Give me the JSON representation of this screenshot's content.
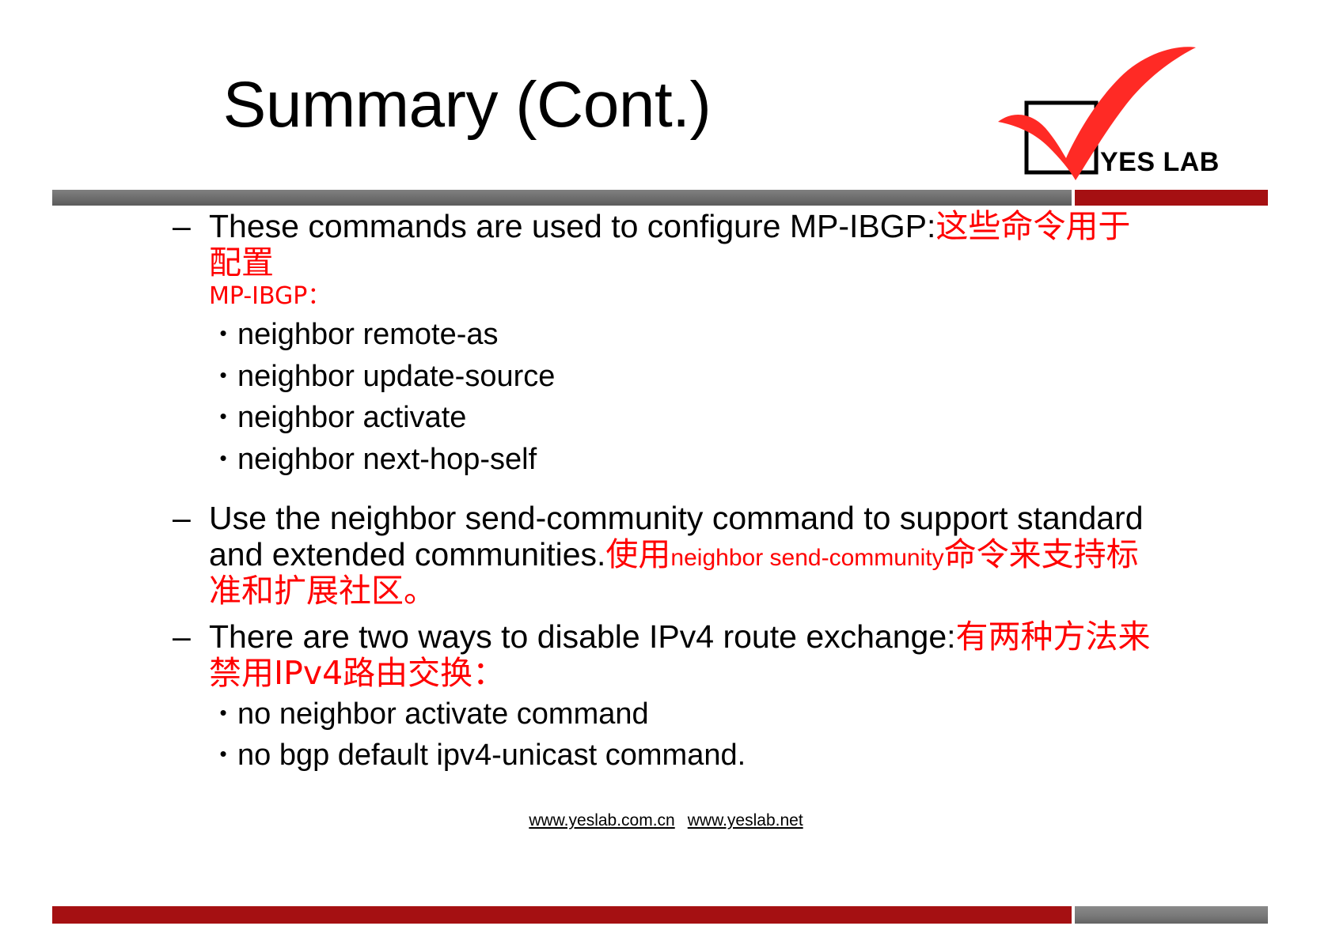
{
  "slide": {
    "title": "Summary (Cont.)",
    "logo": {
      "name": "yes-lab-logo",
      "text": "YES LAB",
      "check_color": "#ff2a25",
      "box_color": "#000000"
    },
    "colors": {
      "rule_gray": "#6e6e6e",
      "rule_red": "#a51012",
      "highlight_red": "#ff0000",
      "text_black": "#000000"
    }
  },
  "content": {
    "blocks": [
      {
        "dash": "–",
        "text_en": "These commands are used to configure MP-IBGP:",
        "text_cn": "这些命令用于配置",
        "text_cn_cont": "MP-IBGP：",
        "sub_bullets": [
          {
            "bullet": "•",
            "text": "neighbor remote-as"
          },
          {
            "bullet": "•",
            "text": "neighbor update-source"
          },
          {
            "bullet": "•",
            "text": "neighbor activate"
          },
          {
            "bullet": "•",
            "text": "neighbor next-hop-self"
          }
        ]
      },
      {
        "dash": "–",
        "text_en": "Use the neighbor send-community command to support standard and extended communities.",
        "text_cn_pre": "使用",
        "text_cn_cmd": "neighbor send-community",
        "text_cn_post": "命令来支持标准和扩展社区。",
        "sub_bullets": []
      },
      {
        "dash": "–",
        "text_en": "There are two ways to disable IPv4 route exchange:",
        "text_cn": "有两种方法来禁用IPv4路由交换：",
        "sub_bullets": [
          {
            "bullet": "•",
            "text": "no neighbor activate command"
          },
          {
            "bullet": "•",
            "text": "no bgp default ipv4-unicast command."
          }
        ]
      }
    ]
  },
  "footer": {
    "link1": "www.yeslab.com.cn",
    "link2": "www.yeslab.net"
  }
}
